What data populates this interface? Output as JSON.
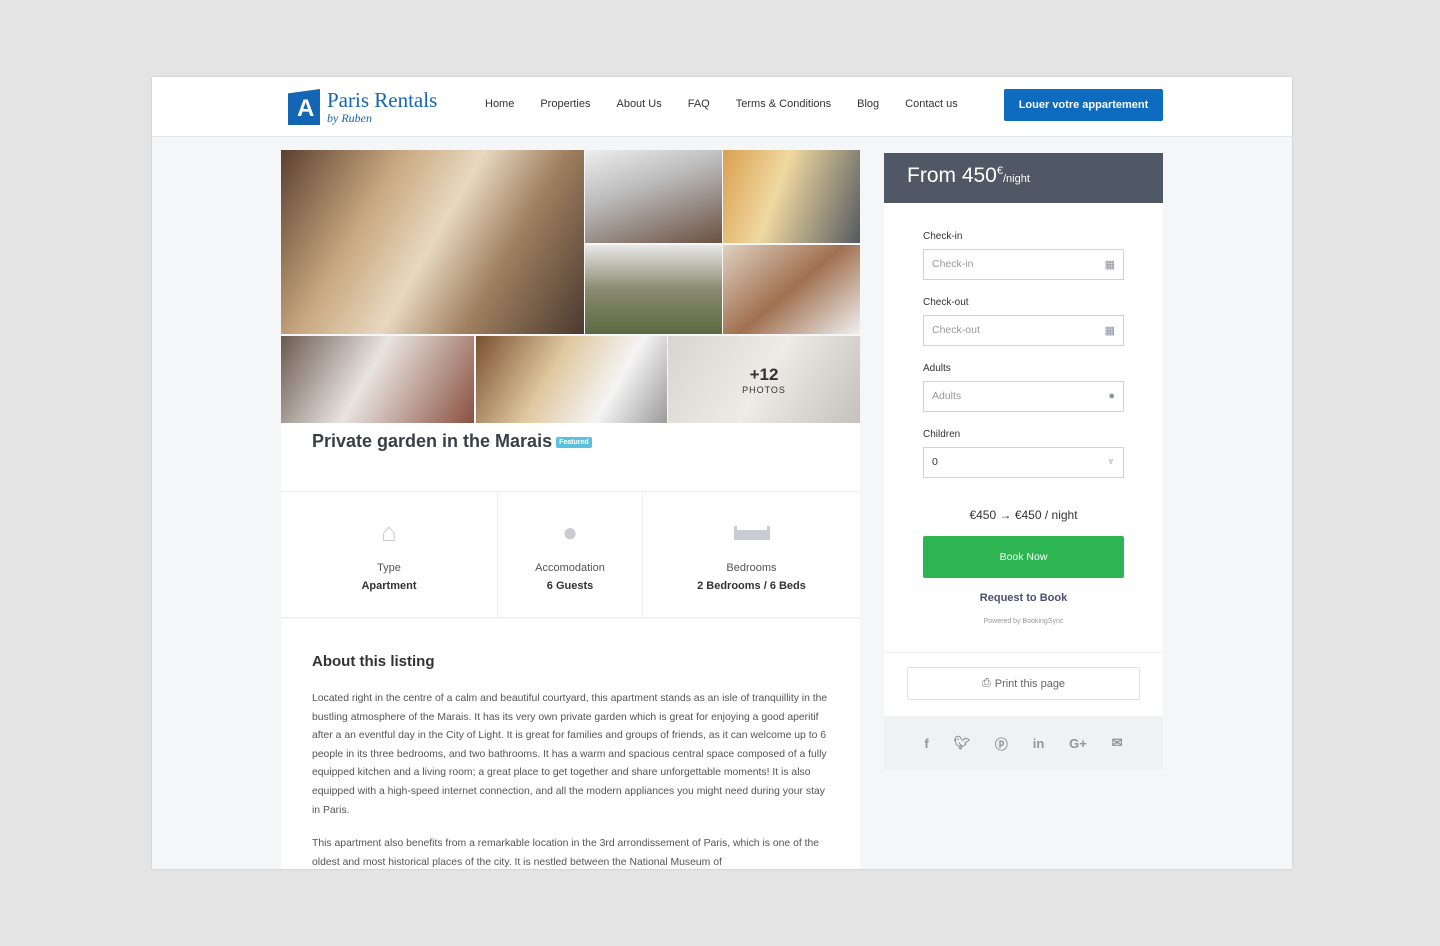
{
  "header": {
    "brand": "Paris Rentals",
    "brand_sub": "by Ruben",
    "nav": [
      "Home",
      "Properties",
      "About Us",
      "FAQ",
      "Terms & Conditions",
      "Blog",
      "Contact us"
    ],
    "cta": "Louer votre appartement"
  },
  "gallery": {
    "more_count": "+12",
    "more_label": "PHOTOS"
  },
  "listing": {
    "title": "Private garden in the Marais",
    "badge": "Featured",
    "features": [
      {
        "icon": "house-icon",
        "label": "Type",
        "value": "Apartment"
      },
      {
        "icon": "user-icon",
        "label": "Accomodation",
        "value": "6 Guests"
      },
      {
        "icon": "bed-icon",
        "label": "Bedrooms",
        "value": "2 Bedrooms / 6 Beds"
      }
    ],
    "about_title": "About this listing",
    "about_p1": "Located right in the centre of a calm and beautiful courtyard, this apartment stands as an isle of tranquillity in the bustling atmosphere of the Marais. It has its very own private garden which is great for enjoying a good aperitif after a an eventful day in the City of Light. It is great for families and groups of friends, as it can welcome up to 6 people in its three bedrooms, and two bathrooms. It has a warm and spacious central space composed of a fully equipped kitchen and a living room; a great place to get together and share unforgettable moments! It is also equipped with a high-speed internet connection, and all the modern appliances you might need during your stay in Paris.",
    "about_p2": "This apartment also benefits from a remarkable location in the 3rd arrondissement of Paris, which is one of the oldest and most historical places of the city. It is nestled between the National Museum of"
  },
  "booking": {
    "price_prefix": "From 450",
    "currency": "€",
    "per": "/night",
    "checkin_label": "Check-in",
    "checkin_placeholder": "Check-in",
    "checkout_label": "Check-out",
    "checkout_placeholder": "Check-out",
    "adults_label": "Adults",
    "adults_placeholder": "Adults",
    "children_label": "Children",
    "children_value": "0",
    "total": "€450 → €450 / night",
    "book_now": "Book Now",
    "request": "Request to Book",
    "powered": "Powered by BookingSync",
    "print": "Print this page"
  },
  "social": [
    "facebook-icon",
    "twitter-icon",
    "pinterest-icon",
    "linkedin-icon",
    "google-plus-icon",
    "email-icon"
  ],
  "colors": {
    "brand": "#1565b5",
    "cta": "#0d6bc0",
    "book": "#2db552",
    "price_bar": "#4f5864"
  }
}
